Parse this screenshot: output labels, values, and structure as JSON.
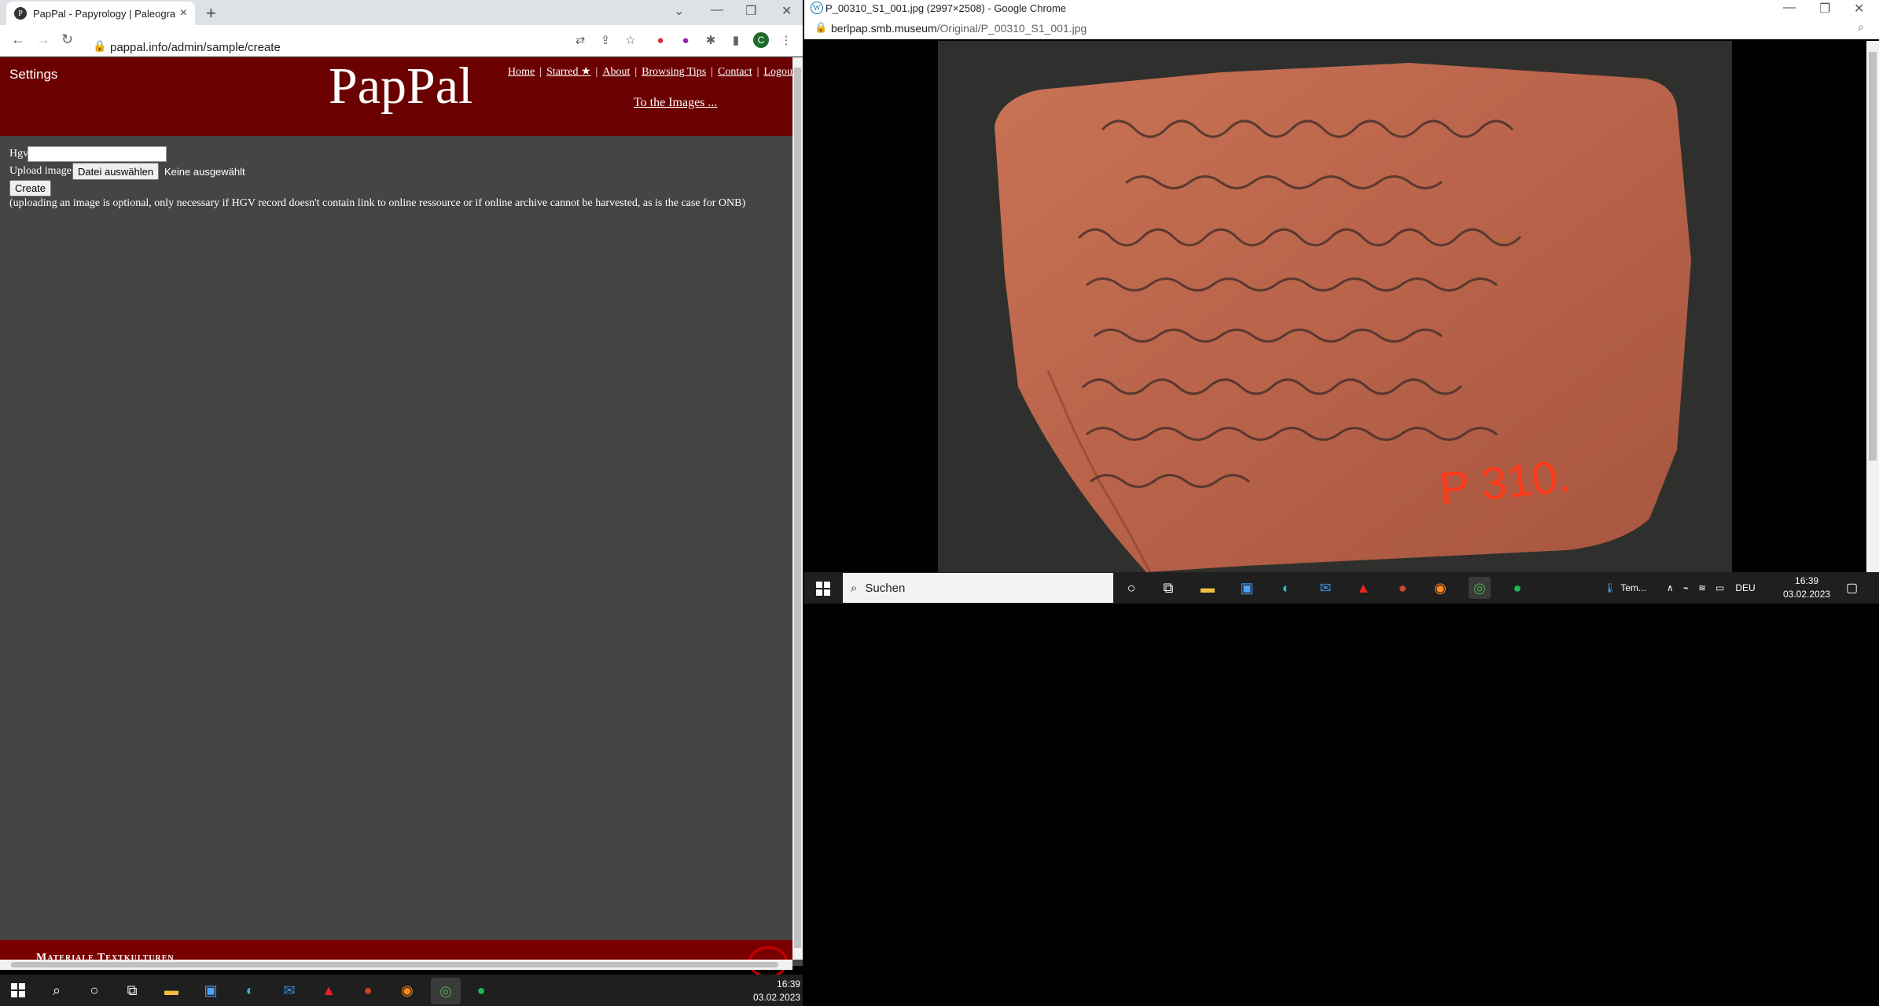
{
  "left_browser": {
    "tab_title": "PapPal - Papyrology | Paleograph",
    "tab_favicon": "P",
    "url": "pappal.info/admin/sample/create",
    "profile_initial": "C"
  },
  "pappal": {
    "settings_label": "Settings",
    "logo": "PapPal",
    "nav": [
      {
        "label": "Home"
      },
      {
        "label": "Starred ★"
      },
      {
        "label": "About"
      },
      {
        "label": "Browsing Tips"
      },
      {
        "label": "Contact"
      },
      {
        "label": "Logout"
      }
    ],
    "to_images_label": "To the Images ...",
    "form": {
      "hgv_label": "Hgv",
      "hgv_value": "",
      "upload_label": "Upload image",
      "file_button_label": "Datei auswählen",
      "file_status": "Keine ausgewählt",
      "create_label": "Create",
      "note": "(uploading an image is optional, only necessary if HGV record doesn't contain link to online ressource or if online archive cannot be harvested, as is the case for ONB)"
    },
    "footer_text": "Materiale Textkulturen",
    "colors": {
      "header": "#6b0000",
      "page_bg": "#454545"
    }
  },
  "right_browser": {
    "window_title": "P_00310_S1_001.jpg (2997×2508) - Google Chrome",
    "url_host": "berlpap.smb.museum",
    "url_path": "/Original/P_00310_S1_001.jpg",
    "image_label": "P 310."
  },
  "inner_taskbar": {
    "search_placeholder": "Suchen",
    "weather": "Tem...",
    "language": "DEU",
    "time": "16:39",
    "date": "03.02.2023"
  },
  "bottom_taskbar": {
    "time": "16:39",
    "date": "03.02.2023"
  }
}
